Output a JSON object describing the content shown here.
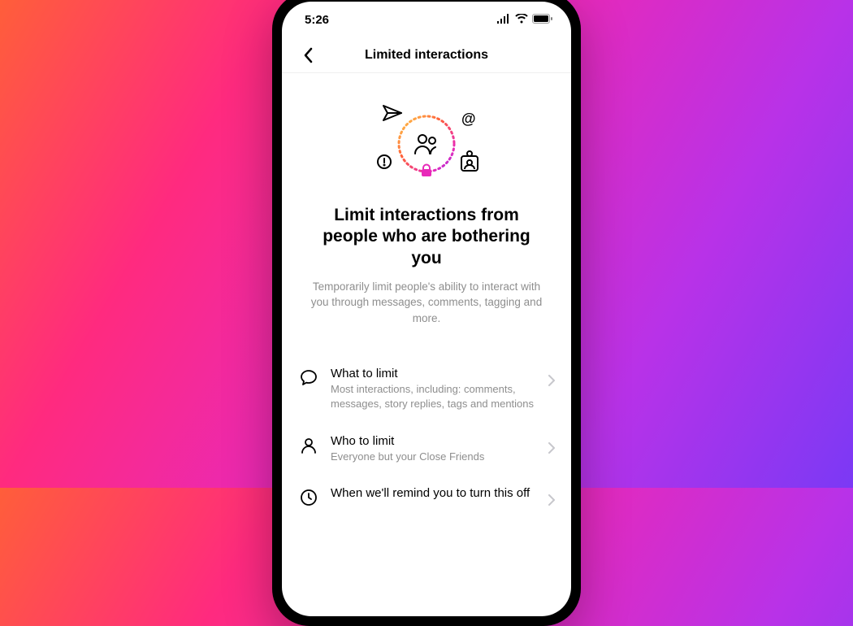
{
  "status_bar": {
    "time": "5:26"
  },
  "nav": {
    "title": "Limited interactions"
  },
  "hero": {
    "title": "Limit interactions from people who are bothering you",
    "subtitle": "Temporarily limit people's ability to interact with you through messages, comments, tagging and more."
  },
  "options": [
    {
      "title": "What to limit",
      "desc": "Most interactions, including: comments, messages, story replies, tags and mentions"
    },
    {
      "title": "Who to limit",
      "desc": "Everyone but your Close Friends"
    },
    {
      "title": "When we'll remind you to turn this off",
      "desc": ""
    }
  ]
}
